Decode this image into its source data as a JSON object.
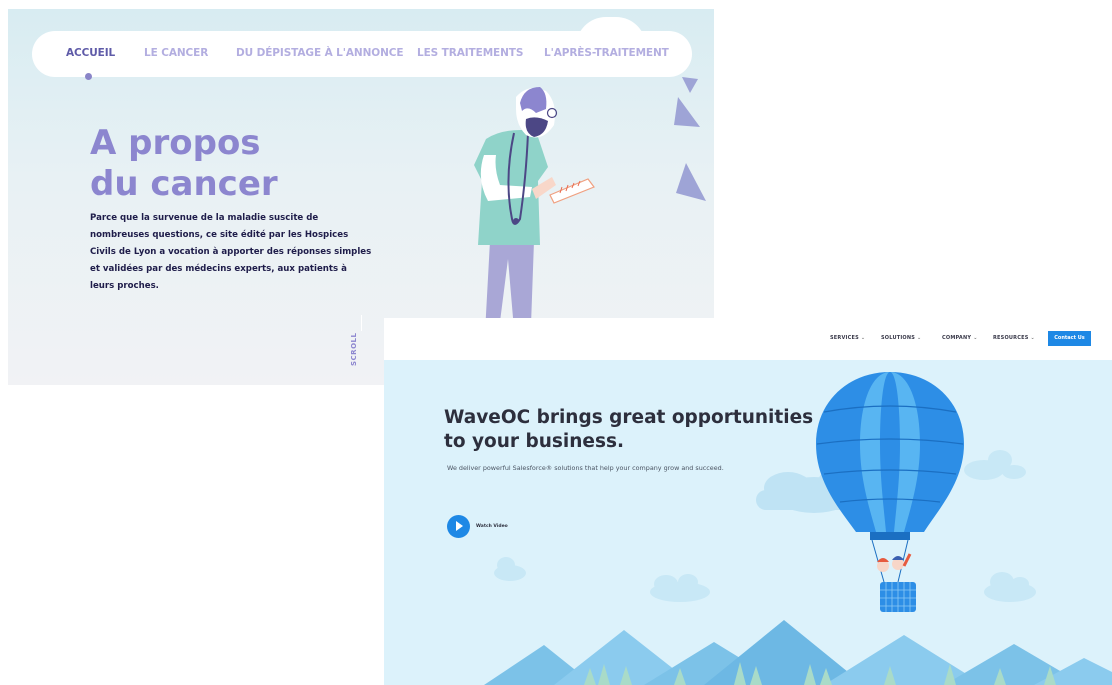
{
  "cancer_site": {
    "nav": {
      "items": [
        "ACCUEIL",
        "LE CANCER",
        "DU DÉPISTAGE À L'ANNONCE",
        "LES TRAITEMENTS",
        "L'APRÈS-TRAITEMENT"
      ],
      "active_index": 0
    },
    "hero": {
      "title_line1": "A propos",
      "title_line2": "du cancer",
      "description": "Parce que la survenue de la maladie suscite de nombreuses questions, ce site édité par les Hospices Civils de Lyon a vocation à apporter des réponses simples et validées par des médecins experts, aux patients à leurs proches."
    },
    "scroll_label": "SCROLL",
    "colors": {
      "accent": "#8c86cf",
      "active_nav": "#5f5ba8",
      "inactive_nav": "#b3aee0",
      "text_dark": "#1f1d4a"
    },
    "illustration": "doctor-with-stethoscope-icon"
  },
  "waveoc_site": {
    "nav": {
      "items": [
        "SERVICES",
        "SOLUTIONS",
        "COMPANY",
        "RESOURCES"
      ],
      "cta_label": "Contact Us"
    },
    "hero": {
      "title_line1": "WaveOC brings great opportunities",
      "title_line2": "to your business.",
      "subtitle": "We deliver powerful Salesforce® solutions that help your company grow and succeed.",
      "video_label": "Watch Video"
    },
    "colors": {
      "primary": "#1e88e5",
      "hero_bg": "#dcf2fb",
      "title": "#2d2f3d"
    },
    "illustration": "hot-air-balloon-icon"
  }
}
